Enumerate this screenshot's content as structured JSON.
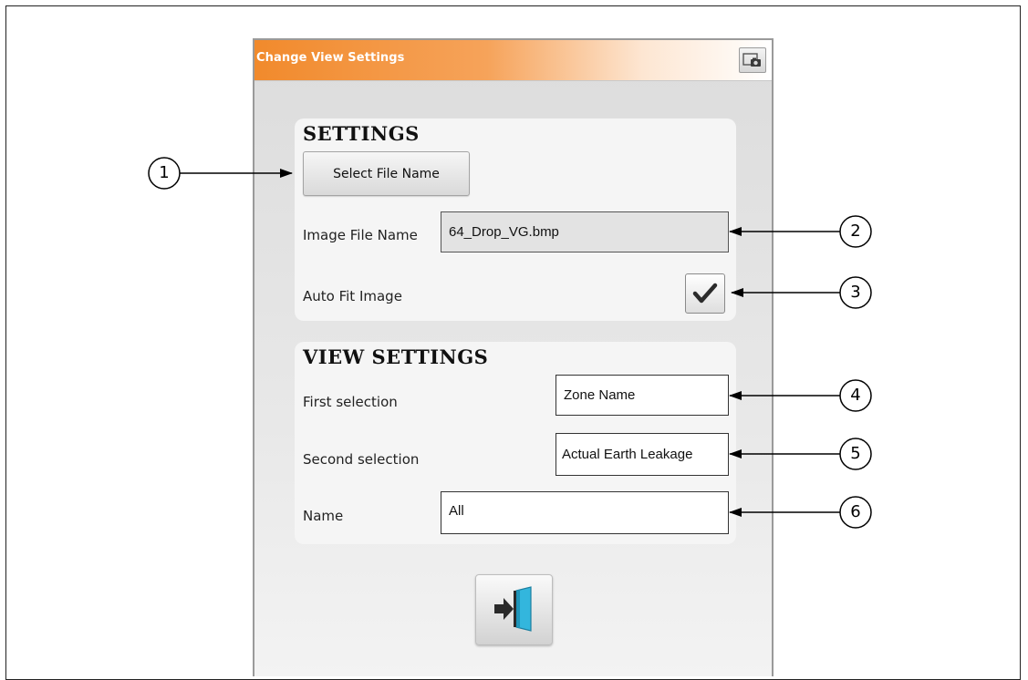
{
  "window": {
    "title": "Change View Settings",
    "accent_color": "#f18a2c",
    "snapshot_icon": "snapshot-icon"
  },
  "settings": {
    "heading": "SETTINGS",
    "select_button_label": "Select File Name",
    "image_file_label": "Image File Name",
    "image_file_value": "64_Drop_VG.bmp",
    "auto_fit_label": "Auto Fit Image",
    "auto_fit_checked": true
  },
  "view_settings": {
    "heading": "VIEW SETTINGS",
    "first_label": "First selection",
    "first_value": "Zone Name",
    "second_label": "Second selection",
    "second_value": "Actual Earth Leakage",
    "name_label": "Name",
    "name_value": "All"
  },
  "footer": {
    "exit_icon": "exit-door-icon"
  },
  "callouts": [
    "1",
    "2",
    "3",
    "4",
    "5",
    "6"
  ]
}
